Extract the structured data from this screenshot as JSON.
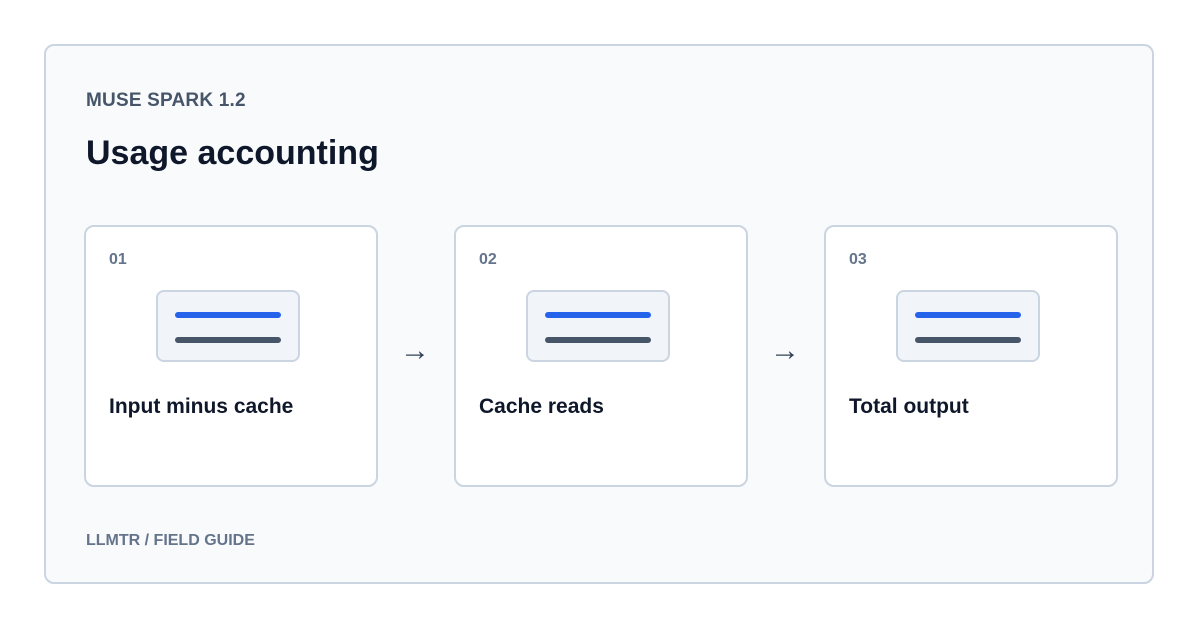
{
  "header": {
    "eyebrow": "MUSE SPARK 1.2",
    "title": "Usage accounting"
  },
  "steps": [
    {
      "number": "01",
      "label": "Input minus cache"
    },
    {
      "number": "02",
      "label": "Cache reads"
    },
    {
      "number": "03",
      "label": "Total output"
    }
  ],
  "connectors": [
    "→",
    "→"
  ],
  "footer": {
    "text": "LLMTR / FIELD GUIDE"
  },
  "colors": {
    "accent": "#2563eb",
    "muted_line": "#475569",
    "border": "#cbd5e1",
    "panel_background": "#f8fafc"
  },
  "icons": {
    "step_icon": "document-lines-icon",
    "connector_icon": "arrow-right-icon"
  }
}
